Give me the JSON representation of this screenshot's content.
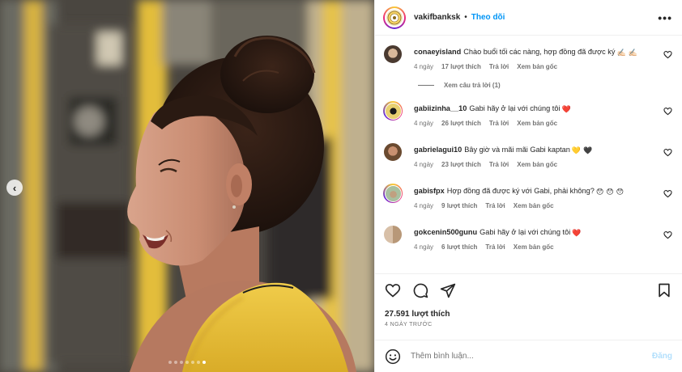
{
  "post": {
    "username": "vakifbanksk",
    "separator": "•",
    "follow_label": "Theo dõi",
    "more_label": "•••"
  },
  "media": {
    "prev_label": "‹",
    "slide_count": 7,
    "active_slide": 7
  },
  "comments": [
    {
      "username": "conaeyisland",
      "text": "Chào buổi tối các nàng, hợp đồng đã được ký",
      "emojis": [
        "✍🏻",
        "✍🏻"
      ],
      "time": "4 ngày",
      "likes": "17 lượt thích",
      "reply_label": "Trả lời",
      "translate_label": "Xem bản gốc",
      "view_replies": "Xem câu trả lời (1)"
    },
    {
      "username": "gabiizinha__10",
      "text": "Gabi hãy ở lại với chúng tôi",
      "emojis": [
        "❤️"
      ],
      "time": "4 ngày",
      "likes": "26 lượt thích",
      "reply_label": "Trả lời",
      "translate_label": "Xem bản gốc"
    },
    {
      "username": "gabrielagui10",
      "text": "Bây giờ và mãi mãi Gabi kaptan",
      "emojis": [
        "💛",
        "🖤"
      ],
      "time": "4 ngày",
      "likes": "23 lượt thích",
      "reply_label": "Trả lời",
      "translate_label": "Xem bản gốc"
    },
    {
      "username": "gabisfpx",
      "text": "Hợp đồng đã được ký với Gabi, phải không?",
      "emojis": [
        "😯",
        "😯",
        "😯"
      ],
      "time": "4 ngày",
      "likes": "9 lượt thích",
      "reply_label": "Trả lời",
      "translate_label": "Xem bản gốc"
    },
    {
      "username": "gokcenin500gunu",
      "text": "Gabi hãy ở lại với chúng tôi",
      "emojis": [
        "❤️"
      ],
      "time": "4 ngày",
      "likes": "6 lượt thích",
      "reply_label": "Trả lời",
      "translate_label": "Xem bản gốc"
    }
  ],
  "stats": {
    "likes": "27.591 lượt thích",
    "date": "4 NGÀY TRƯỚC"
  },
  "composer": {
    "placeholder": "Thêm bình luận...",
    "post_label": "Đăng"
  },
  "colors": {
    "accent": "#0095f6",
    "heart_red": "#ed2939",
    "text": "#262626",
    "muted": "#737373",
    "shirt_yellow": "#e8c33a"
  }
}
